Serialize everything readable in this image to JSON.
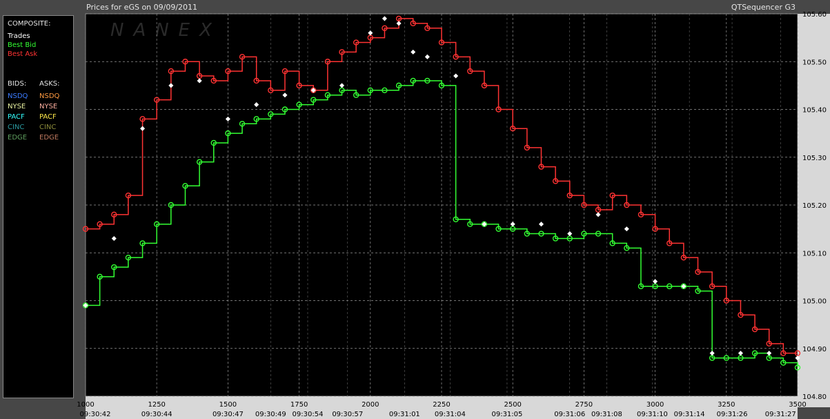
{
  "header": {
    "title": "Prices for  eGS  on  09/09/2011",
    "app_name": "QTSequencer G3",
    "watermark": "NANEX"
  },
  "legend": {
    "composite_heading": "COMPOSITE:",
    "composite": [
      {
        "label": "Trades",
        "color": "#ffffff"
      },
      {
        "label": "Best Bid",
        "color": "#33ff33"
      },
      {
        "label": "Best Ask",
        "color": "#ff3333"
      }
    ],
    "bids_heading": "BIDS:",
    "asks_heading": "ASKS:",
    "bids": [
      {
        "label": "NSDQ",
        "color": "#3b7bff"
      },
      {
        "label": "NYSE",
        "color": "#e8f0a0"
      },
      {
        "label": "PACF",
        "color": "#33ffff"
      },
      {
        "label": "CINC",
        "color": "#2a9aa0"
      },
      {
        "label": "EDGE",
        "color": "#5f9f5f"
      }
    ],
    "asks": [
      {
        "label": "NSDQ",
        "color": "#ff9a40"
      },
      {
        "label": "NYSE",
        "color": "#ffb0a0"
      },
      {
        "label": "PACF",
        "color": "#ffe94a"
      },
      {
        "label": "CINC",
        "color": "#8c8c3a"
      },
      {
        "label": "EDGE",
        "color": "#c07a60"
      }
    ]
  },
  "chart_data": {
    "type": "line",
    "title": "Prices for  eGS  on  09/09/2011",
    "xlabel": "",
    "ylabel": "",
    "xlim": [
      1000,
      3500
    ],
    "ylim": [
      104.8,
      105.6
    ],
    "grid": true,
    "x_ticks": [
      1000,
      1250,
      1500,
      1750,
      2000,
      2250,
      2500,
      2750,
      3000,
      3250,
      3500
    ],
    "y_ticks": [
      "104.80",
      "104.90",
      "105.00",
      "105.10",
      "105.20",
      "105.30",
      "105.40",
      "105.50",
      "105.60"
    ],
    "time_labels": [
      {
        "x": 1000,
        "label": "09:30:42"
      },
      {
        "x": 1250,
        "label": "09:30:44"
      },
      {
        "x": 1500,
        "label": "09:30:47"
      },
      {
        "x": 1650,
        "label": "09:30:49"
      },
      {
        "x": 1780,
        "label": "09:30:54"
      },
      {
        "x": 1920,
        "label": "09:30:57"
      },
      {
        "x": 2120,
        "label": "09:31:01"
      },
      {
        "x": 2280,
        "label": "09:31:04"
      },
      {
        "x": 2480,
        "label": "09:31:05"
      },
      {
        "x": 2700,
        "label": "09:31:06"
      },
      {
        "x": 2830,
        "label": "09:31:08"
      },
      {
        "x": 2990,
        "label": "09:31:10"
      },
      {
        "x": 3120,
        "label": "09:31:14"
      },
      {
        "x": 3270,
        "label": "09:31:26"
      },
      {
        "x": 3440,
        "label": "09:31:27"
      }
    ],
    "series": [
      {
        "name": "Best Ask",
        "color": "#ff3333",
        "x": [
          1000,
          1050,
          1100,
          1150,
          1200,
          1250,
          1300,
          1350,
          1400,
          1450,
          1500,
          1550,
          1600,
          1650,
          1700,
          1750,
          1800,
          1850,
          1900,
          1950,
          2000,
          2050,
          2100,
          2150,
          2200,
          2250,
          2300,
          2350,
          2400,
          2450,
          2500,
          2550,
          2600,
          2650,
          2700,
          2750,
          2800,
          2850,
          2900,
          2950,
          3000,
          3050,
          3100,
          3150,
          3200,
          3250,
          3300,
          3350,
          3400,
          3450,
          3500
        ],
        "y": [
          105.15,
          105.16,
          105.18,
          105.22,
          105.38,
          105.42,
          105.48,
          105.5,
          105.47,
          105.46,
          105.48,
          105.51,
          105.46,
          105.44,
          105.48,
          105.45,
          105.44,
          105.5,
          105.52,
          105.54,
          105.55,
          105.57,
          105.59,
          105.58,
          105.57,
          105.54,
          105.51,
          105.48,
          105.45,
          105.4,
          105.36,
          105.32,
          105.28,
          105.25,
          105.22,
          105.2,
          105.19,
          105.22,
          105.2,
          105.18,
          105.15,
          105.12,
          105.09,
          105.06,
          105.03,
          105.0,
          104.97,
          104.94,
          104.91,
          104.89,
          104.89
        ]
      },
      {
        "name": "Best Bid",
        "color": "#33ff33",
        "x": [
          1000,
          1050,
          1100,
          1150,
          1200,
          1250,
          1300,
          1350,
          1400,
          1450,
          1500,
          1550,
          1600,
          1650,
          1700,
          1750,
          1800,
          1850,
          1900,
          1950,
          2000,
          2050,
          2100,
          2150,
          2200,
          2250,
          2300,
          2350,
          2400,
          2450,
          2500,
          2550,
          2600,
          2650,
          2700,
          2750,
          2800,
          2850,
          2900,
          2950,
          3000,
          3050,
          3100,
          3150,
          3200,
          3250,
          3300,
          3350,
          3400,
          3450,
          3500
        ],
        "y": [
          104.99,
          105.05,
          105.07,
          105.09,
          105.12,
          105.16,
          105.2,
          105.24,
          105.29,
          105.33,
          105.35,
          105.37,
          105.38,
          105.39,
          105.4,
          105.41,
          105.42,
          105.43,
          105.44,
          105.43,
          105.44,
          105.44,
          105.45,
          105.46,
          105.46,
          105.45,
          105.17,
          105.16,
          105.16,
          105.15,
          105.15,
          105.14,
          105.14,
          105.13,
          105.13,
          105.14,
          105.14,
          105.12,
          105.11,
          105.03,
          105.03,
          105.03,
          105.03,
          105.02,
          104.88,
          104.88,
          104.88,
          104.89,
          104.88,
          104.87,
          104.86
        ]
      },
      {
        "name": "Trades",
        "color": "#ffffff",
        "x": [
          1000,
          1100,
          1200,
          1300,
          1400,
          1500,
          1600,
          1700,
          1800,
          1900,
          2000,
          2050,
          2100,
          2150,
          2200,
          2300,
          2400,
          2500,
          2600,
          2700,
          2800,
          2900,
          3000,
          3100,
          3200,
          3300,
          3400,
          3500
        ],
        "y": [
          104.99,
          105.13,
          105.36,
          105.45,
          105.46,
          105.38,
          105.41,
          105.43,
          105.44,
          105.45,
          105.56,
          105.59,
          105.58,
          105.52,
          105.51,
          105.47,
          105.16,
          105.16,
          105.16,
          105.14,
          105.18,
          105.15,
          105.04,
          105.03,
          104.89,
          104.89,
          104.89,
          104.88
        ]
      }
    ]
  }
}
